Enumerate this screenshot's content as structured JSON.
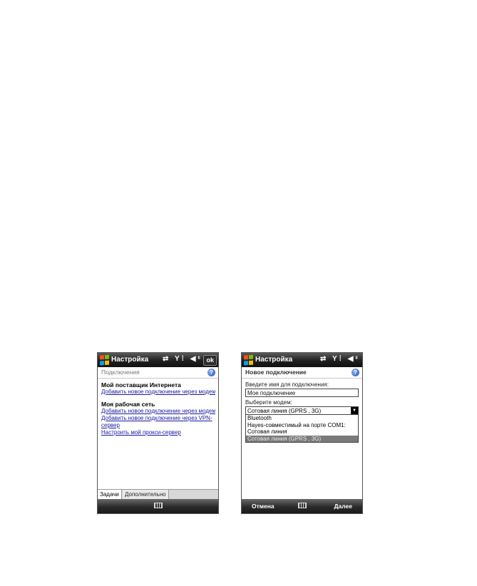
{
  "left_screen": {
    "title": "Настройка",
    "status_icons": "⇄ Y⁞ ◀ᵋ",
    "ok_label": "ok",
    "header": "Подключения",
    "section1_title": "Мой поставщик Интернета",
    "section1_link": "Добавить новое подключение через модем",
    "section2_title": "Моя рабочая сеть",
    "section2_links": [
      "Добавить новое подключение через модем",
      "Добавить новое подключение через VPN-",
      "сервер",
      "Настроить мой прокси-сервер"
    ],
    "tabs": [
      "Задачи",
      "Дополнительно"
    ]
  },
  "right_screen": {
    "title": "Настройка",
    "status_icons": "⇄ Y⁞ ◀ᵋ",
    "header": "Новое подключение",
    "name_label": "Введите имя для подключения:",
    "name_value": "Мое подключение",
    "modem_label": "Выберите модем:",
    "modem_selected": "Сотовая линия (GPRS , 3G)",
    "modem_options": [
      "Bluetooth",
      "Hayes-совместимый на порте COM1:",
      "Сотовая линия",
      "Сотовая линия (GPRS , 3G)"
    ],
    "softkey_left": "Отмена",
    "softkey_right": "Далее"
  },
  "colors": {
    "titlebar": "#1f1f1f",
    "link": "#1a1aa0",
    "help_icon": "#1c4fb3",
    "selected_option": "#7a7a7a"
  },
  "icons": [
    "windows-start-icon",
    "help-icon",
    "keyboard-icon",
    "connectivity-icon",
    "signal-icon",
    "volume-icon"
  ]
}
